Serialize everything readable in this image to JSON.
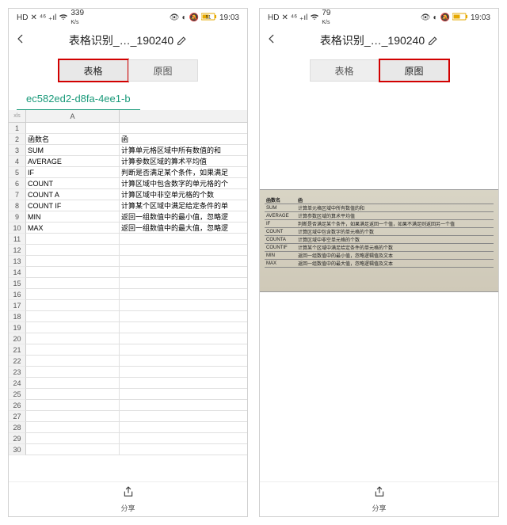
{
  "statusbar": {
    "hd": "HD",
    "sim": "✕",
    "signal": "⁴⁶ ₊ıl",
    "wifi_icon": "wifi",
    "speed_left": "339",
    "speed_right": "79",
    "speed_unit": "K/s",
    "eye": "👁",
    "moon": "◐",
    "bell": "🔕",
    "battery": "51",
    "time": "19:03"
  },
  "header": {
    "title": "表格识别_…_190240"
  },
  "tabs": {
    "table": "表格",
    "original": "原图"
  },
  "sheet": {
    "name": "ec582ed2-d8fa-4ee1-b",
    "corner": "xls",
    "colA": "A",
    "rows": [
      {
        "n": 1,
        "a": "",
        "b": ""
      },
      {
        "n": 2,
        "a": "函数名",
        "b": "函"
      },
      {
        "n": 3,
        "a": "SUM",
        "b": "计算单元格区域中所有数值的和"
      },
      {
        "n": 4,
        "a": "AVERAGE",
        "b": "计算参数区域的算术平均值"
      },
      {
        "n": 5,
        "a": "IF",
        "b": "判断是否满足某个条件，如果满足"
      },
      {
        "n": 6,
        "a": "COUNT",
        "b": "计算区域中包含数字的单元格的个"
      },
      {
        "n": 7,
        "a": "COUNT A",
        "b": "计算区域中非空单元格的个数"
      },
      {
        "n": 8,
        "a": "COUNT IF",
        "b": "计算某个区域中满足给定条件的单"
      },
      {
        "n": 9,
        "a": "MIN",
        "b": "返回一组数值中的最小值，忽略逻"
      },
      {
        "n": 10,
        "a": "MAX",
        "b": "返回一组数值中的最大值，忽略逻"
      },
      {
        "n": 11,
        "a": "",
        "b": ""
      },
      {
        "n": 12,
        "a": "",
        "b": ""
      },
      {
        "n": 13,
        "a": "",
        "b": ""
      },
      {
        "n": 14,
        "a": "",
        "b": ""
      },
      {
        "n": 15,
        "a": "",
        "b": ""
      },
      {
        "n": 16,
        "a": "",
        "b": ""
      },
      {
        "n": 17,
        "a": "",
        "b": ""
      },
      {
        "n": 18,
        "a": "",
        "b": ""
      },
      {
        "n": 19,
        "a": "",
        "b": ""
      },
      {
        "n": 20,
        "a": "",
        "b": ""
      },
      {
        "n": 21,
        "a": "",
        "b": ""
      },
      {
        "n": 22,
        "a": "",
        "b": ""
      },
      {
        "n": 23,
        "a": "",
        "b": ""
      },
      {
        "n": 24,
        "a": "",
        "b": ""
      },
      {
        "n": 25,
        "a": "",
        "b": ""
      },
      {
        "n": 26,
        "a": "",
        "b": ""
      },
      {
        "n": 27,
        "a": "",
        "b": ""
      },
      {
        "n": 28,
        "a": "",
        "b": ""
      },
      {
        "n": 29,
        "a": "",
        "b": ""
      },
      {
        "n": 30,
        "a": "",
        "b": ""
      }
    ]
  },
  "original_table": {
    "rows": [
      {
        "a": "函数名",
        "b": "函"
      },
      {
        "a": "SUM",
        "b": "计算单元格区域中所有数值的和"
      },
      {
        "a": "AVERAGE",
        "b": "计算参数区域的算术平均值"
      },
      {
        "a": "IF",
        "b": "判断是否满足某个条件，如果满足返回一个值，如果不满足则返回另一个值"
      },
      {
        "a": "COUNT",
        "b": "计算区域中包含数字的单元格的个数"
      },
      {
        "a": "COUNTA",
        "b": "计算区域中非空单元格的个数"
      },
      {
        "a": "COUNTIF",
        "b": "计算某个区域中满足给定条件的单元格的个数"
      },
      {
        "a": "MIN",
        "b": "返回一组数值中的最小值，忽略逻辑值及文本"
      },
      {
        "a": "MAX",
        "b": "返回一组数值中的最大值，忽略逻辑值及文本"
      }
    ]
  },
  "bottom": {
    "share": "分享"
  }
}
